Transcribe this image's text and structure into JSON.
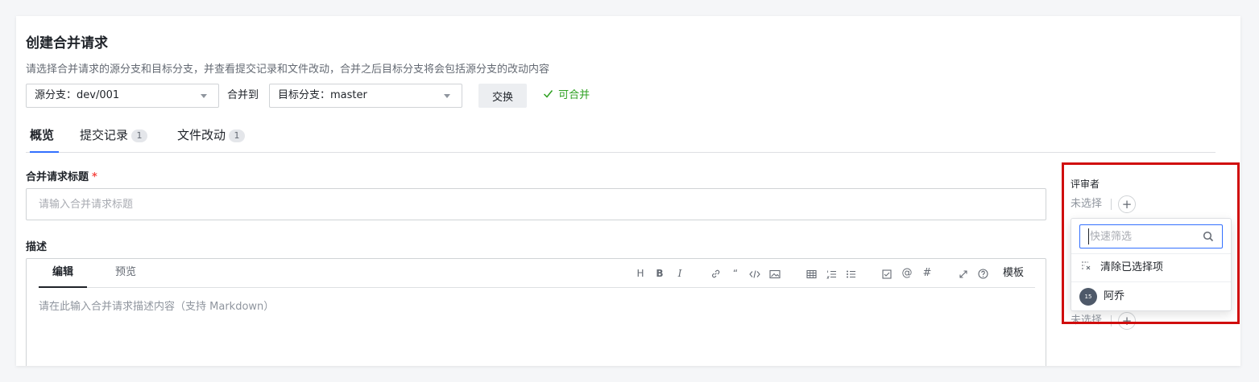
{
  "header": {
    "title": "创建合并请求",
    "description": "请选择合并请求的源分支和目标分支，并查看提交记录和文件改动，合并之后目标分支将会包括源分支的改动内容"
  },
  "branches": {
    "source": "源分支：dev/001",
    "merge_to": "合并到",
    "target": "目标分支：master",
    "swap_label": "交换",
    "status": "可合并"
  },
  "tabs": [
    {
      "label": "概览"
    },
    {
      "label": "提交记录",
      "count": "1"
    },
    {
      "label": "文件改动",
      "count": "1"
    }
  ],
  "form": {
    "title_label": "合并请求标题",
    "required_mark": "*",
    "title_placeholder": "请输入合并请求标题",
    "desc_label": "描述",
    "editor_tabs": [
      "编辑",
      "预览"
    ],
    "toolbar": {
      "h": "H",
      "b": "B",
      "i": "I",
      "quote": "“",
      "at": "@",
      "hash": "#",
      "template": "模板"
    },
    "desc_placeholder": "请在此输入合并请求描述内容（支持 Markdown）"
  },
  "sidebar": {
    "reviewers_label": "评审者",
    "unselected": "未选择",
    "add": "+",
    "dropdown": {
      "filter_placeholder": "快速筛选",
      "clear_label": "清除已选择项",
      "users": [
        {
          "name": "阿乔",
          "avatar": "15"
        }
      ]
    }
  },
  "colors": {
    "accent": "#3370ff",
    "success": "#2ea121",
    "highlight": "#d00d0d"
  }
}
